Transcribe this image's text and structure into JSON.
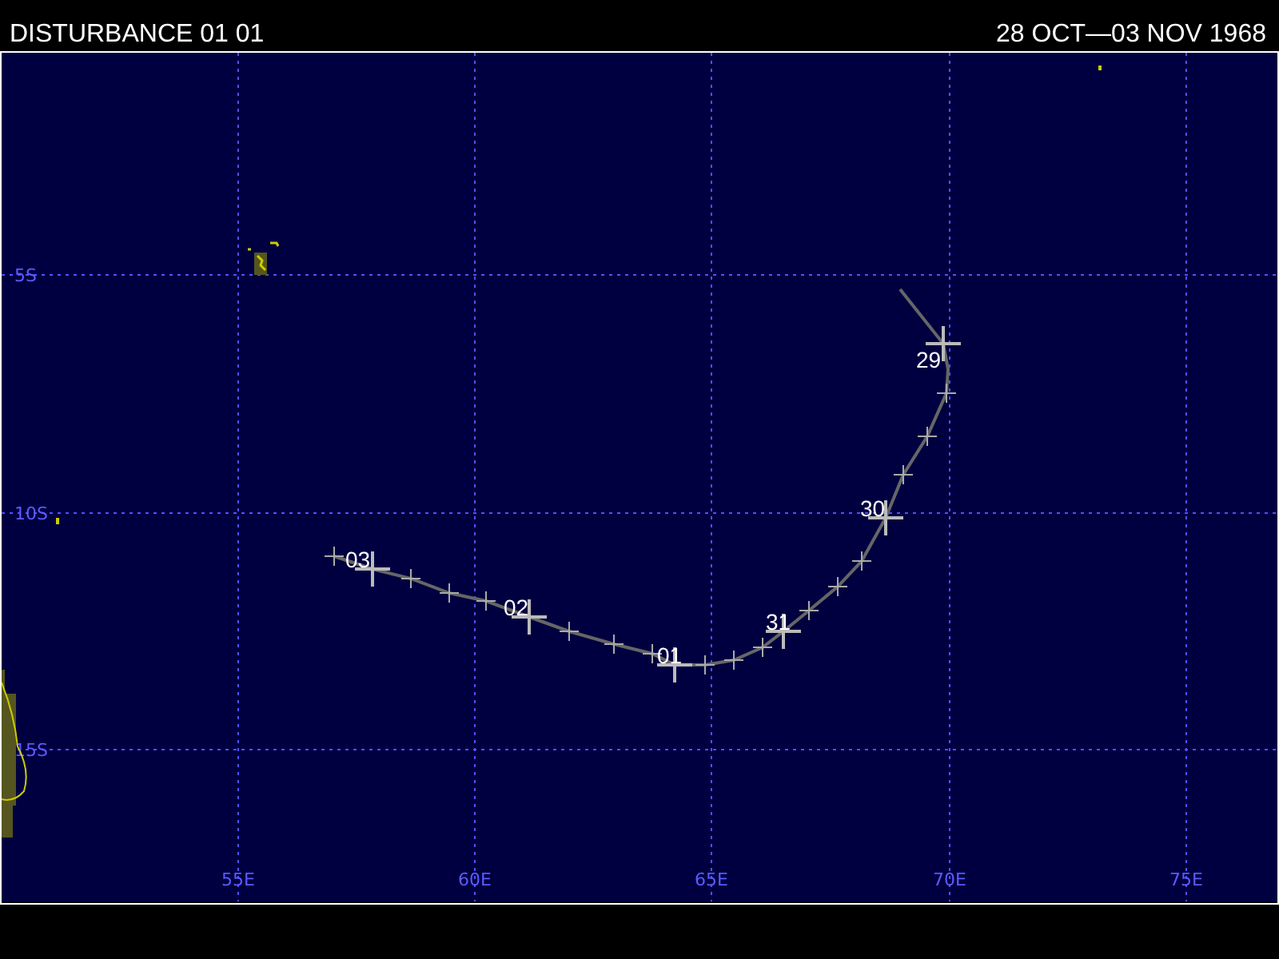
{
  "header": {
    "title": "DISTURBANCE 01 01",
    "period": "28 OCT—03 NOV 1968"
  },
  "map": {
    "latitude_labels": [
      "5S",
      "10S",
      "15S"
    ],
    "longitude_labels": [
      "55E",
      "60E",
      "65E",
      "70E",
      "75E"
    ],
    "track_labels": [
      "29",
      "30",
      "31",
      "01",
      "02",
      "03"
    ]
  }
}
